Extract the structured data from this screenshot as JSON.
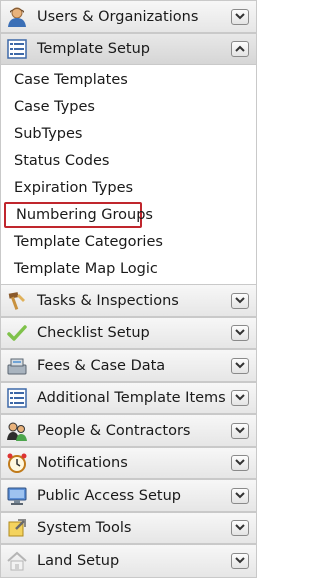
{
  "sections": {
    "users": {
      "label": "Users & Organizations",
      "icon": "user-icon"
    },
    "template": {
      "label": "Template Setup",
      "icon": "list-icon"
    },
    "tasks": {
      "label": "Tasks & Inspections",
      "icon": "hammer-icon"
    },
    "checklist": {
      "label": "Checklist Setup",
      "icon": "checkmark-icon"
    },
    "fees": {
      "label": "Fees & Case Data",
      "icon": "cash-register-icon"
    },
    "additional": {
      "label": "Additional Template Items",
      "icon": "list-icon"
    },
    "people": {
      "label": "People & Contractors",
      "icon": "people-icon"
    },
    "notifications": {
      "label": "Notifications",
      "icon": "alarm-clock-icon"
    },
    "public": {
      "label": "Public Access Setup",
      "icon": "computer-icon"
    },
    "system": {
      "label": "System Tools",
      "icon": "wrench-icon"
    },
    "land": {
      "label": "Land Setup",
      "icon": "house-icon"
    }
  },
  "template_items": [
    "Case Templates",
    "Case Types",
    "SubTypes",
    "Status Codes",
    "Expiration Types",
    "Numbering Groups",
    "Template Categories",
    "Template Map Logic"
  ],
  "selected_item": "Numbering Groups"
}
